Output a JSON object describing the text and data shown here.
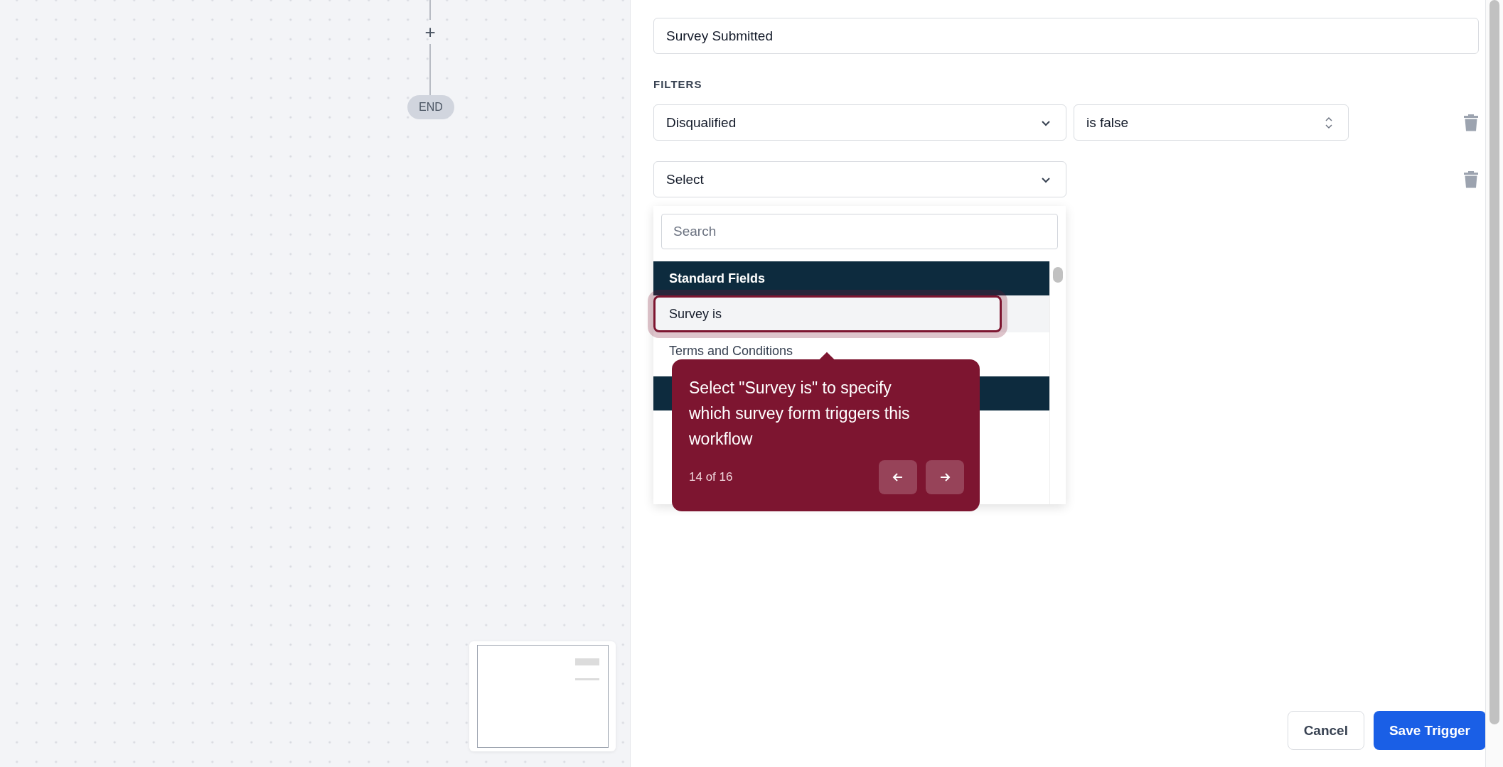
{
  "canvas": {
    "flow_nodes": [
      {
        "kind": "add",
        "label": "+"
      },
      {
        "kind": "end",
        "label": "END"
      }
    ]
  },
  "trigger_name": {
    "value": "Survey Submitted"
  },
  "filters": {
    "title": "FILTERS",
    "rows": [
      {
        "field": "Disqualified",
        "operator": "is false"
      },
      {
        "field": "Select"
      }
    ]
  },
  "dropdown": {
    "search": {
      "placeholder": "Search"
    },
    "groups": [
      {
        "title": "Standard Fields",
        "items": [
          {
            "label": "Survey is",
            "selected": true
          },
          {
            "label": "Terms and Conditions",
            "selected": false
          }
        ]
      }
    ]
  },
  "tour": {
    "text": "Select \"Survey is\" to specify which survey form triggers this workflow",
    "progress": "14 of 16"
  },
  "actions": [
    {
      "label": "Cancel",
      "kind": "secondary"
    },
    {
      "label": "Save Trigger",
      "kind": "primary"
    }
  ]
}
